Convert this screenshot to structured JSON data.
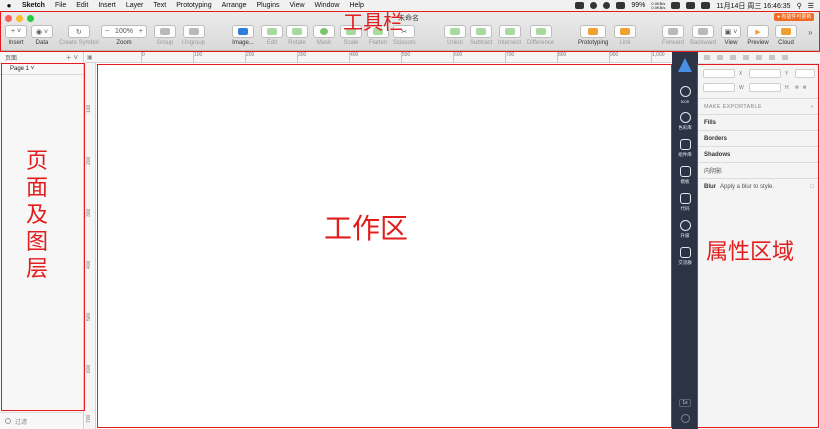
{
  "menubar": {
    "app": "Sketch",
    "items": [
      "File",
      "Edit",
      "Insert",
      "Layer",
      "Text",
      "Prototyping",
      "Arrange",
      "Plugins",
      "View",
      "Window",
      "Help"
    ],
    "battery": "99%",
    "net_up": "0.0KB/s",
    "net_down": "0.0KB/s",
    "datetime": "11月14日 周三  16:46:35"
  },
  "window": {
    "title": "未命名",
    "update_badge": "● 有插件可更新"
  },
  "toolbar": {
    "insert": "Insert",
    "data": "Data",
    "create_symbol": "Create Symbol",
    "zoom_value": "100%",
    "zoom_minus": "−",
    "zoom_plus": "+",
    "zoom": "Zoom",
    "group": "Group",
    "ungroup": "Ungroup",
    "image": "Image...",
    "edit": "Edit",
    "rotate": "Rotate",
    "mask": "Mask",
    "scale": "Scale",
    "flatten": "Flatten",
    "scissors": "Scissors",
    "union": "Union",
    "subtract": "Subtract",
    "intersect": "Intersect",
    "difference": "Difference",
    "prototyping": "Prototyping",
    "link": "Link",
    "forward": "Forward",
    "backward": "Backward",
    "view": "View",
    "preview": "Preview",
    "cloud": "Cloud"
  },
  "left_panel": {
    "pages_header": "页面",
    "page_item": "Page 1",
    "filter": "过滤"
  },
  "ruler": {
    "top_ticks": [
      "0",
      "100",
      "200",
      "300",
      "400",
      "500",
      "600",
      "700",
      "800",
      "900",
      "1,000"
    ],
    "left_ticks": [
      "100",
      "200",
      "300",
      "400",
      "500",
      "600",
      "700"
    ]
  },
  "icon_sidebar": {
    "items": [
      "Icon",
      "色彩库",
      "组件库",
      "模板",
      "代码",
      "升级",
      "交流群"
    ],
    "zoom": "1x"
  },
  "inspector": {
    "x": "X",
    "y": "Y",
    "w": "W",
    "h": "H",
    "exportable": "MAKE EXPORTABLE",
    "fills": "Fills",
    "borders": "Borders",
    "shadows": "Shadows",
    "inner_shadows": "内阴影",
    "blur": "Blur",
    "blur_hint": "Apply a blur to style."
  },
  "annotations": {
    "toolbar": "工具栏",
    "pages_layers": "页面及图层",
    "workspace": "工作区",
    "properties": "属性区域"
  },
  "colors": {
    "annotation": "#e11d1d",
    "sidebar": "#2c3345",
    "badge": "#f26b21"
  }
}
